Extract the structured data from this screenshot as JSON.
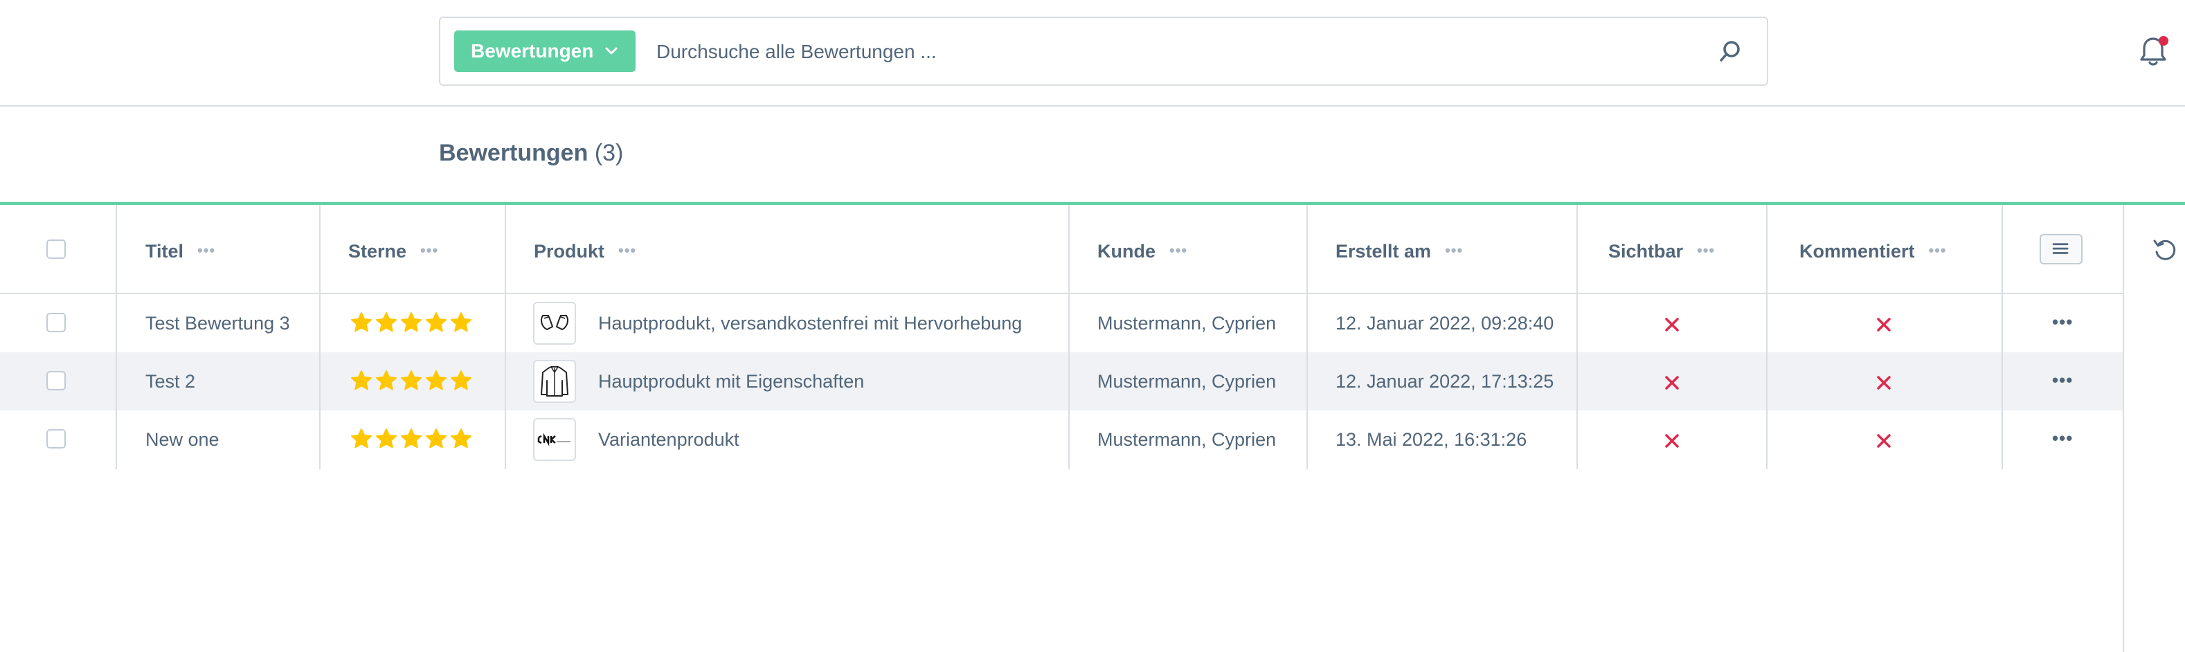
{
  "search": {
    "type_label": "Bewertungen",
    "placeholder": "Durchsuche alle Bewertungen ..."
  },
  "page": {
    "title": "Bewertungen",
    "count": "(3)"
  },
  "columns": {
    "title": "Titel",
    "stars": "Sterne",
    "product": "Produkt",
    "customer": "Kunde",
    "created": "Erstellt am",
    "visible": "Sichtbar",
    "commented": "Kommentiert"
  },
  "rows": [
    {
      "title": "Test Bewertung 3",
      "stars": 5,
      "product": "Hauptprodukt, versandkostenfrei mit Hervorhebung",
      "customer": "Mustermann, Cyprien",
      "created": "12. Januar 2022, 09:28:40",
      "visible": false,
      "commented": false
    },
    {
      "title": "Test 2",
      "stars": 5,
      "product": "Hauptprodukt mit Eigenschaften",
      "customer": "Mustermann, Cyprien",
      "created": "12. Januar 2022, 17:13:25",
      "visible": false,
      "commented": false
    },
    {
      "title": "New one",
      "stars": 5,
      "product": "Variantenprodukt",
      "customer": "Mustermann, Cyprien",
      "created": "13. Mai 2022, 16:31:26",
      "visible": false,
      "commented": false
    }
  ],
  "icons": {
    "search": "search-icon",
    "bell": "bell-icon",
    "settings": "list-settings-icon",
    "undo": "undo-icon",
    "star": "star-icon",
    "false": "x-icon"
  },
  "colors": {
    "accent": "#5fd1a2",
    "star": "#ffc700",
    "negative": "#de294c",
    "notification": "#de294c"
  }
}
